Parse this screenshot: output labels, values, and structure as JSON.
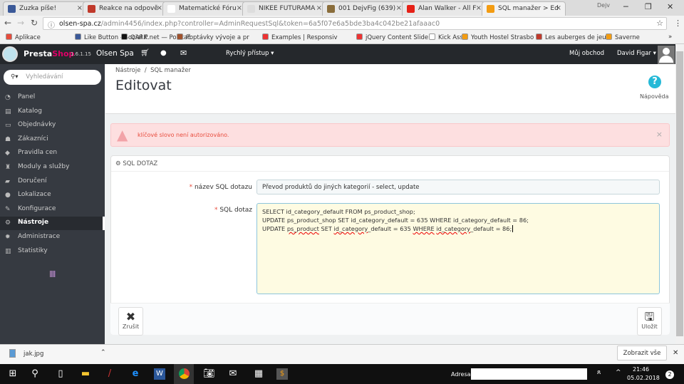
{
  "browser": {
    "tabs": [
      {
        "title": "Zuzka píše!",
        "color": "#3b5998"
      },
      {
        "title": "Reakce na odpově",
        "color": "#c0392b"
      },
      {
        "title": "Matematické Fóru",
        "color": "#fff"
      },
      {
        "title": "NIKEE FUTURAMA",
        "color": "#ddd"
      },
      {
        "title": "001 DejvFig (639)",
        "color": "#8a6d3b"
      },
      {
        "title": "Alan Walker - All F",
        "color": "#e62117"
      },
      {
        "title": "SQL manažer > Ed",
        "color": "#f39c12",
        "active": true
      }
    ],
    "user_label": "Dejv",
    "url_host": "olsen-spa.cz",
    "url_path": "/admin4456/index.php?controller=AdminRequestSql&token=6a5f07e6a5bde3ba4c042be21afaaac0",
    "bookmarks": [
      "Aplikace",
      "Like Button - Social P",
      "QARK.net — Počítač",
      "Poptávky vývoje a pr",
      "Examples | Responsiv",
      "jQuery Content Slide",
      "Kick Ass",
      "Youth Hostel Strasbo",
      "Les auberges de jeun",
      "Saverne"
    ],
    "bookmarks_more": "»"
  },
  "header": {
    "brand_a": "Presta",
    "brand_b": "Shop",
    "version": "1.6.1.15",
    "shop": "Olsen Spa",
    "quick": "Rychlý přístup ▾",
    "my_shop": "Můj obchod",
    "user": "David Figar ▾"
  },
  "sidebar": {
    "search_placeholder": "Vyhledávání",
    "items": [
      {
        "label": "Panel",
        "icon": "◔"
      },
      {
        "label": "Katalog",
        "icon": "▤"
      },
      {
        "label": "Objednávky",
        "icon": "▭"
      },
      {
        "label": "Zákazníci",
        "icon": "☗"
      },
      {
        "label": "Pravidla cen",
        "icon": "◆"
      },
      {
        "label": "Moduly a služby",
        "icon": "♜"
      },
      {
        "label": "Doručení",
        "icon": "▰"
      },
      {
        "label": "Lokalizace",
        "icon": "●"
      },
      {
        "label": "Konfigurace",
        "icon": "✎"
      },
      {
        "label": "Nástroje",
        "icon": "⚙",
        "active": true
      },
      {
        "label": "Administrace",
        "icon": "✹"
      },
      {
        "label": "Statistiky",
        "icon": "▥"
      }
    ]
  },
  "page": {
    "breadcrumb_a": "Nástroje",
    "breadcrumb_sep": "/",
    "breadcrumb_b": "SQL manažer",
    "title": "Editovat",
    "help": "Nápověda"
  },
  "alert": {
    "message": "klíčové slovo není autorizováno.",
    "close": "×"
  },
  "panel": {
    "heading": "SQL DOTAZ",
    "name_label": "název SQL dotazu",
    "name_value": "Převod produktů do jiných kategorií - select, update",
    "sql_label": "SQL dotaz",
    "sql_lines": [
      "SELECT id_category_default FROM ps_product_shop;",
      "UPDATE ps_product_shop SET id_category_default = 635 WHERE id_category_default = 86;",
      "UPDATE ps_product SET id_category_default = 635 WHERE id_category_default = 86;"
    ],
    "cancel": "Zrušit",
    "save": "Uložit"
  },
  "download": {
    "file": "jak.jpg",
    "show_all": "Zobrazit vše"
  },
  "taskbar": {
    "address_label": "Adresa",
    "time": "21:46",
    "date": "05.02.2018",
    "notifications": "2"
  }
}
